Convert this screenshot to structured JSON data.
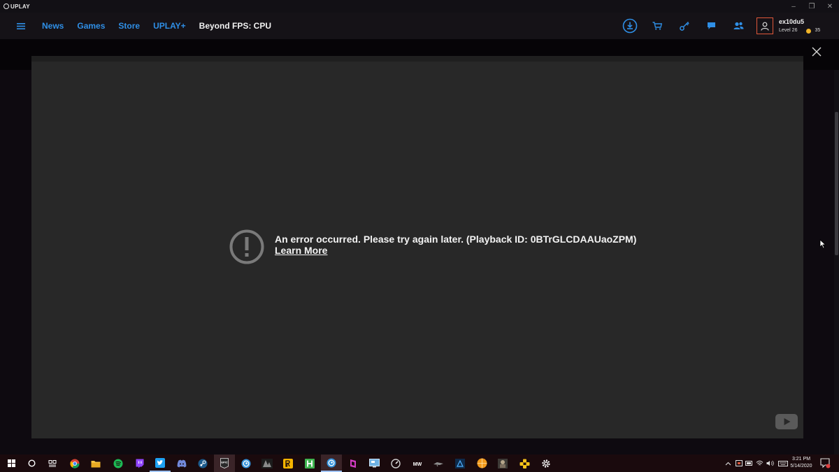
{
  "titlebar": {
    "app_name": "UPLAY",
    "controls": [
      "–",
      "❐",
      "✕"
    ]
  },
  "nav": {
    "links": [
      {
        "label": "News"
      },
      {
        "label": "Games"
      },
      {
        "label": "Store"
      },
      {
        "label": "UPLAY+"
      }
    ],
    "current_page": "Beyond FPS: CPU",
    "icons": [
      "download-icon",
      "cart-icon",
      "key-icon",
      "chat-icon",
      "friends-icon"
    ]
  },
  "profile": {
    "username": "ex10du5",
    "level": "Level 26",
    "coins": "35"
  },
  "video": {
    "error_message": "An error occurred. Please try again later. (Playback ID: 0BTrGLCDAAUaoZPM)",
    "learn_more": "Learn More"
  },
  "taskbar": {
    "apps": [
      "start-icon",
      "cortana-icon",
      "task-view-icon",
      "chrome-icon",
      "file-explorer-icon",
      "spotify-icon",
      "twitch-icon",
      "twitter-icon",
      "discord-icon",
      "steam-icon",
      "epic-games-icon",
      "uplay-icon",
      "game-icon",
      "rockstar-icon",
      "h-app-icon",
      "uplay-active-icon",
      "app-icon",
      "control-panel-icon",
      "speedtest-icon",
      "mw-icon",
      "game-2-icon",
      "game-3-icon",
      "ball-icon",
      "game-4-icon",
      "controller-icon",
      "settings-icon"
    ],
    "epic_label": "EPIC",
    "mw_label": "MW",
    "time": "3:21 PM",
    "date": "5/14/2020"
  },
  "colors": {
    "accent": "#2f8fe6",
    "profile_border": "#e0583a",
    "coin": "#f0b429",
    "video_bg": "#282828"
  }
}
